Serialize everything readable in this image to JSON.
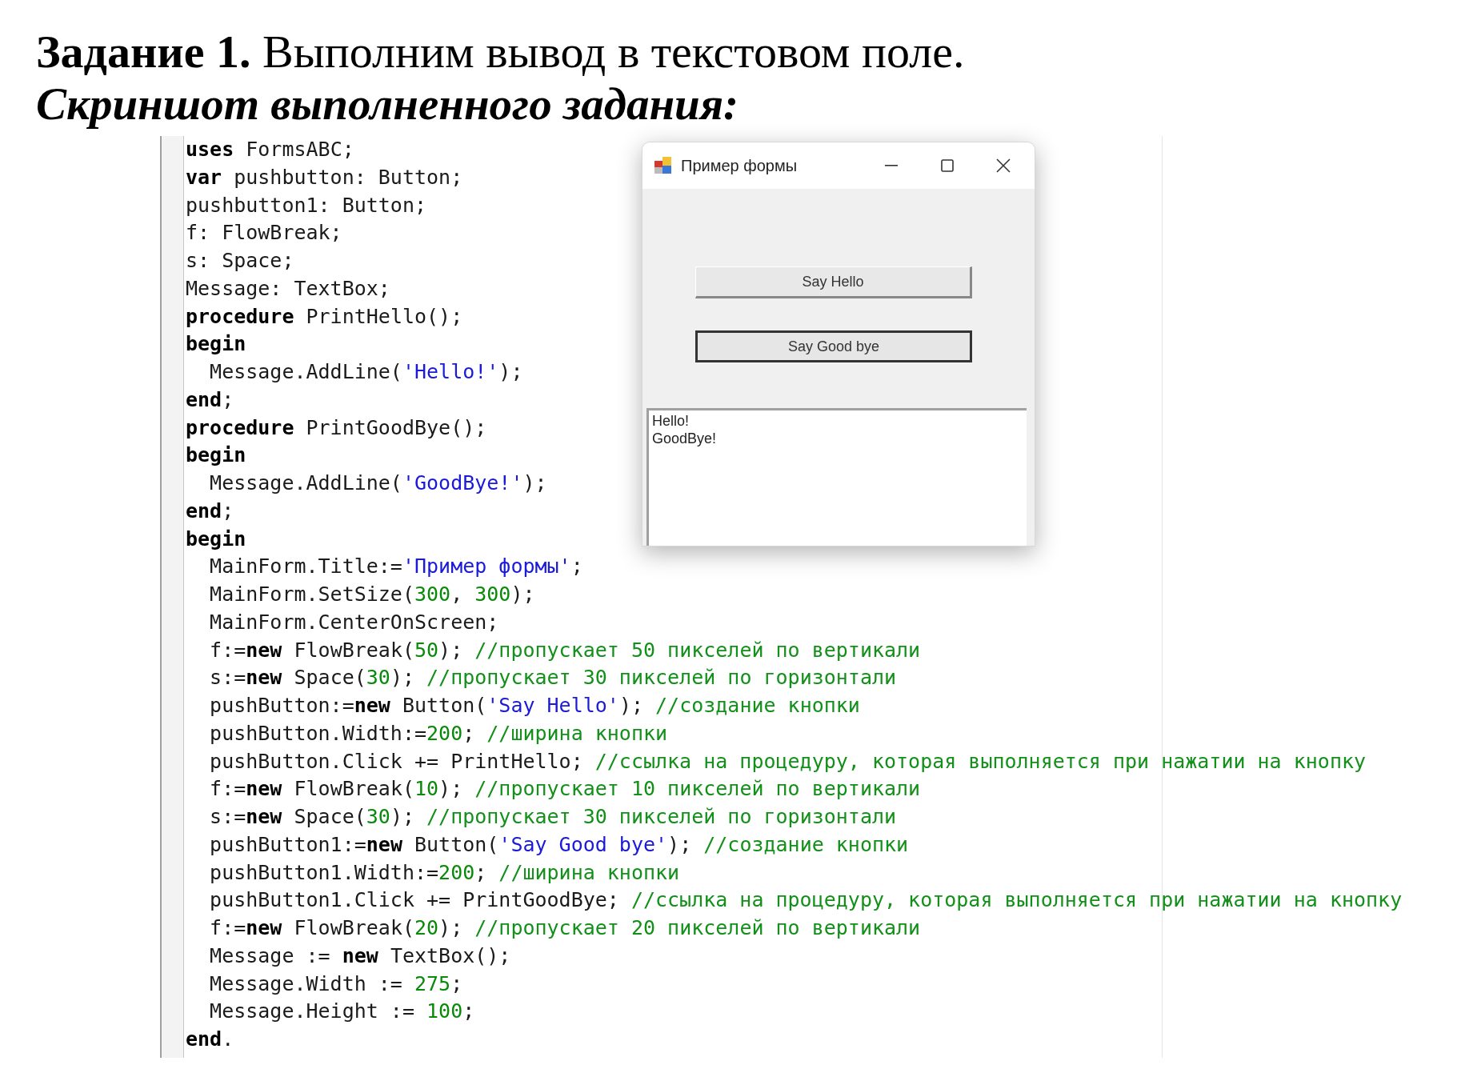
{
  "heading": "**Задание 1.** Выполним вывод в текстовом поле.",
  "subheading": "Скриншот выполненного задания:",
  "code": {
    "lines": [
      [
        {
          "kind": "kw",
          "text": "uses"
        },
        {
          "kind": "plain",
          "text": " FormsABC;"
        }
      ],
      [
        {
          "kind": "kw",
          "text": "var"
        },
        {
          "kind": "plain",
          "text": " pushbutton: Button;"
        }
      ],
      [
        {
          "kind": "plain",
          "text": "pushbutton1: Button;"
        }
      ],
      [
        {
          "kind": "plain",
          "text": "f: FlowBreak;"
        }
      ],
      [
        {
          "kind": "plain",
          "text": "s: Space;"
        }
      ],
      [
        {
          "kind": "plain",
          "text": "Message: TextBox;"
        }
      ],
      [
        {
          "kind": "kw",
          "text": "procedure"
        },
        {
          "kind": "plain",
          "text": " PrintHello();"
        }
      ],
      [
        {
          "kind": "kw",
          "text": "begin"
        }
      ],
      [
        {
          "kind": "plain",
          "text": "  Message.AddLine("
        },
        {
          "kind": "str",
          "text": "'Hello!'"
        },
        {
          "kind": "plain",
          "text": ");"
        }
      ],
      [
        {
          "kind": "kw",
          "text": "end"
        },
        {
          "kind": "plain",
          "text": ";"
        }
      ],
      [
        {
          "kind": "kw",
          "text": "procedure"
        },
        {
          "kind": "plain",
          "text": " PrintGoodBye();"
        }
      ],
      [
        {
          "kind": "kw",
          "text": "begin"
        }
      ],
      [
        {
          "kind": "plain",
          "text": "  Message.AddLine("
        },
        {
          "kind": "str",
          "text": "'GoodBye!'"
        },
        {
          "kind": "plain",
          "text": ");"
        }
      ],
      [
        {
          "kind": "kw",
          "text": "end"
        },
        {
          "kind": "plain",
          "text": ";"
        }
      ],
      [
        {
          "kind": "kw",
          "text": "begin"
        }
      ],
      [
        {
          "kind": "plain",
          "text": "  MainForm.Title:="
        },
        {
          "kind": "str",
          "text": "'Пример формы'"
        },
        {
          "kind": "plain",
          "text": ";"
        }
      ],
      [
        {
          "kind": "plain",
          "text": "  MainForm.SetSize("
        },
        {
          "kind": "num",
          "text": "300"
        },
        {
          "kind": "plain",
          "text": ", "
        },
        {
          "kind": "num",
          "text": "300"
        },
        {
          "kind": "plain",
          "text": ");"
        }
      ],
      [
        {
          "kind": "plain",
          "text": "  MainForm.CenterOnScreen;"
        }
      ],
      [
        {
          "kind": "plain",
          "text": "  f:="
        },
        {
          "kind": "kw",
          "text": "new"
        },
        {
          "kind": "plain",
          "text": " FlowBreak("
        },
        {
          "kind": "num",
          "text": "50"
        },
        {
          "kind": "plain",
          "text": "); "
        },
        {
          "kind": "comment",
          "text": "//пропускает 50 пикселей по вертикали"
        }
      ],
      [
        {
          "kind": "plain",
          "text": "  s:="
        },
        {
          "kind": "kw",
          "text": "new"
        },
        {
          "kind": "plain",
          "text": " Space("
        },
        {
          "kind": "num",
          "text": "30"
        },
        {
          "kind": "plain",
          "text": "); "
        },
        {
          "kind": "comment",
          "text": "//пропускает 30 пикселей по горизонтали"
        }
      ],
      [
        {
          "kind": "plain",
          "text": "  pushButton:="
        },
        {
          "kind": "kw",
          "text": "new"
        },
        {
          "kind": "plain",
          "text": " Button("
        },
        {
          "kind": "str",
          "text": "'Say Hello'"
        },
        {
          "kind": "plain",
          "text": "); "
        },
        {
          "kind": "comment",
          "text": "//создание кнопки"
        }
      ],
      [
        {
          "kind": "plain",
          "text": "  pushButton.Width:="
        },
        {
          "kind": "num",
          "text": "200"
        },
        {
          "kind": "plain",
          "text": "; "
        },
        {
          "kind": "comment",
          "text": "//ширина кнопки"
        }
      ],
      [
        {
          "kind": "plain",
          "text": "  pushButton.Click += PrintHello; "
        },
        {
          "kind": "comment",
          "text": "//ссылка на процедуру, которая выполняется при нажатии на кнопку"
        }
      ],
      [
        {
          "kind": "plain",
          "text": "  f:="
        },
        {
          "kind": "kw",
          "text": "new"
        },
        {
          "kind": "plain",
          "text": " FlowBreak("
        },
        {
          "kind": "num",
          "text": "10"
        },
        {
          "kind": "plain",
          "text": "); "
        },
        {
          "kind": "comment",
          "text": "//пропускает 10 пикселей по вертикали"
        }
      ],
      [
        {
          "kind": "plain",
          "text": "  s:="
        },
        {
          "kind": "kw",
          "text": "new"
        },
        {
          "kind": "plain",
          "text": " Space("
        },
        {
          "kind": "num",
          "text": "30"
        },
        {
          "kind": "plain",
          "text": "); "
        },
        {
          "kind": "comment",
          "text": "//пропускает 30 пикселей по горизонтали"
        }
      ],
      [
        {
          "kind": "plain",
          "text": "  pushButton1:="
        },
        {
          "kind": "kw",
          "text": "new"
        },
        {
          "kind": "plain",
          "text": " Button("
        },
        {
          "kind": "str",
          "text": "'Say Good bye'"
        },
        {
          "kind": "plain",
          "text": "); "
        },
        {
          "kind": "comment",
          "text": "//создание кнопки"
        }
      ],
      [
        {
          "kind": "plain",
          "text": "  pushButton1.Width:="
        },
        {
          "kind": "num",
          "text": "200"
        },
        {
          "kind": "plain",
          "text": "; "
        },
        {
          "kind": "comment",
          "text": "//ширина кнопки"
        }
      ],
      [
        {
          "kind": "plain",
          "text": "  pushButton1.Click += PrintGoodBye; "
        },
        {
          "kind": "comment",
          "text": "//ссылка на процедуру, которая выполняется при нажатии на кнопку"
        }
      ],
      [
        {
          "kind": "plain",
          "text": "  f:="
        },
        {
          "kind": "kw",
          "text": "new"
        },
        {
          "kind": "plain",
          "text": " FlowBreak("
        },
        {
          "kind": "num",
          "text": "20"
        },
        {
          "kind": "plain",
          "text": "); "
        },
        {
          "kind": "comment",
          "text": "//пропускает 20 пикселей по вертикали"
        }
      ],
      [
        {
          "kind": "plain",
          "text": "  Message := "
        },
        {
          "kind": "kw",
          "text": "new"
        },
        {
          "kind": "plain",
          "text": " TextBox();"
        }
      ],
      [
        {
          "kind": "plain",
          "text": "  Message.Width := "
        },
        {
          "kind": "num",
          "text": "275"
        },
        {
          "kind": "plain",
          "text": ";"
        }
      ],
      [
        {
          "kind": "plain",
          "text": "  Message.Height := "
        },
        {
          "kind": "num",
          "text": "100"
        },
        {
          "kind": "plain",
          "text": ";"
        }
      ],
      [
        {
          "kind": "kw",
          "text": "end"
        },
        {
          "kind": "plain",
          "text": "."
        }
      ]
    ]
  },
  "form_window": {
    "title": "Пример формы",
    "buttons": [
      {
        "label": "Say Hello",
        "focused": false
      },
      {
        "label": "Say Good bye",
        "focused": true
      }
    ],
    "textbox": {
      "lines": [
        "Hello!",
        "GoodBye!"
      ]
    }
  }
}
